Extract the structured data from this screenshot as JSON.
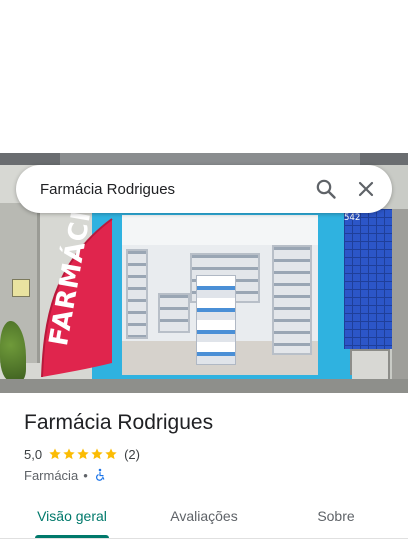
{
  "search": {
    "query": "Farmácia Rodrigues"
  },
  "photo": {
    "flag_text": "FARMÁCIA",
    "building_number": "542"
  },
  "place": {
    "name": "Farmácia Rodrigues",
    "rating": "5,0",
    "stars": 5,
    "review_count": "(2)",
    "category": "Farmácia",
    "separator": "•",
    "wheelchair_accessible": true
  },
  "tabs": [
    {
      "label": "Visão geral",
      "active": true
    },
    {
      "label": "Avaliações",
      "active": false
    },
    {
      "label": "Sobre",
      "active": false
    }
  ],
  "colors": {
    "accent": "#00796b",
    "star": "#fbbc04",
    "accessibility_icon": "#1a73e8",
    "flag": "#e0254d",
    "storefront_frame": "#2fb2e0"
  },
  "icons": {
    "search": "search-icon",
    "close": "close-icon",
    "wheelchair": "wheelchair-icon",
    "star": "star-icon"
  }
}
